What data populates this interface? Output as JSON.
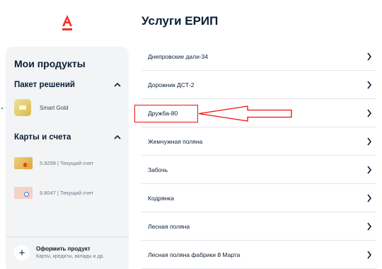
{
  "logo": {
    "icon": "alfa-bank-logo",
    "color": "#ef3124"
  },
  "sidebar": {
    "title": "Мои продукты",
    "packages": {
      "heading": "Пакет решений",
      "items": [
        {
          "label": "Smart Gold",
          "icon": "gold-card-icon"
        }
      ]
    },
    "accounts": {
      "heading": "Карты и счета",
      "items": [
        {
          "label": "5.9299 | Текущий счет",
          "icon": "mastercard-card-icon"
        },
        {
          "label": "9.8047 | Текущий счет",
          "icon": "pink-card-icon"
        }
      ]
    },
    "add_product": {
      "title": "Оформить продукт",
      "subtitle": "Карты, кредиты, вклады и др."
    }
  },
  "main": {
    "title": "Услуги ЕРИП",
    "services": [
      {
        "label": "Днепровские дали-34"
      },
      {
        "label": "Дорожник ДСТ-2"
      },
      {
        "label": "Дружба-80",
        "highlighted": true
      },
      {
        "label": "Жемчужная поляна"
      },
      {
        "label": "Забочь"
      },
      {
        "label": "Кодрянка"
      },
      {
        "label": "Лесная поляна"
      },
      {
        "label": "Лесная поляна фабрики 8 Марта"
      }
    ]
  },
  "annotation": {
    "color": "#e11111",
    "target": "Дружба-80"
  }
}
